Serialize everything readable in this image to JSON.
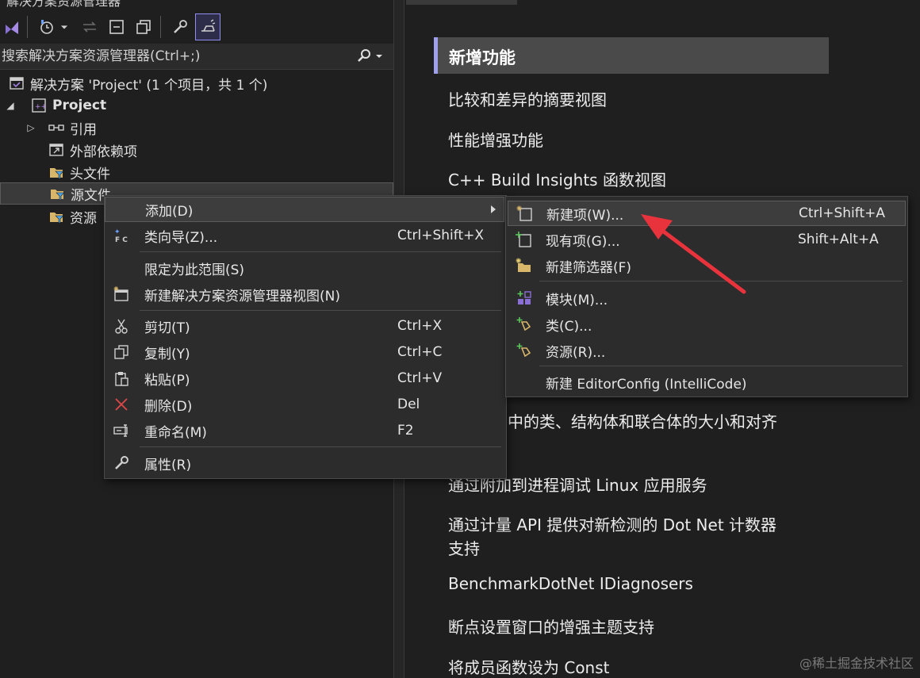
{
  "window": {
    "title_fragment": "解决方案资源管理器"
  },
  "search": {
    "placeholder": "搜索解决方案资源管理器(Ctrl+;)"
  },
  "tree": {
    "solution": "解决方案 'Project' (1 个项目，共 1 个)",
    "project": "Project",
    "references": "引用",
    "external_deps": "外部依赖项",
    "header_files": "头文件",
    "source_files": "源文件",
    "resource_files": "资源"
  },
  "context_menu": {
    "items": [
      {
        "label": "添加(D)",
        "shortcut": ""
      },
      {
        "label": "类向导(Z)...",
        "shortcut": "Ctrl+Shift+X"
      },
      {
        "label": "限定为此范围(S)",
        "shortcut": ""
      },
      {
        "label": "新建解决方案资源管理器视图(N)",
        "shortcut": ""
      },
      {
        "label": "剪切(T)",
        "shortcut": "Ctrl+X"
      },
      {
        "label": "复制(Y)",
        "shortcut": "Ctrl+C"
      },
      {
        "label": "粘贴(P)",
        "shortcut": "Ctrl+V"
      },
      {
        "label": "删除(D)",
        "shortcut": "Del"
      },
      {
        "label": "重命名(M)",
        "shortcut": "F2"
      },
      {
        "label": "属性(R)",
        "shortcut": ""
      }
    ]
  },
  "submenu": {
    "items": [
      {
        "label": "新建项(W)...",
        "shortcut": "Ctrl+Shift+A"
      },
      {
        "label": "现有项(G)...",
        "shortcut": "Shift+Alt+A"
      },
      {
        "label": "新建筛选器(F)",
        "shortcut": ""
      },
      {
        "label": "模块(M)...",
        "shortcut": ""
      },
      {
        "label": "类(C)...",
        "shortcut": ""
      },
      {
        "label": "资源(R)...",
        "shortcut": ""
      },
      {
        "label": "新建 EditorConfig (IntelliCode)",
        "shortcut": ""
      }
    ]
  },
  "whats_new": {
    "header": "新增功能",
    "items": [
      "比较和差异的摘要视图",
      "性能增强功能",
      "C++ Build Insights 函数视图",
      "息中的类、结构体和联合体的大小和对齐",
      "通过附加到进程调试 Linux 应用服务",
      "通过计量 API 提供对新检测的 Dot Net 计数器",
      "支持",
      "BenchmarkDotNet IDiagnosers",
      "断点设置窗口的增强主题支持",
      "将成员函数设为 Const"
    ]
  },
  "watermark": "@稀土掘金技术社区",
  "colors": {
    "accent": "#9f9fee",
    "annotation_arrow": "#e8323c",
    "background": "#1f1f1f"
  }
}
